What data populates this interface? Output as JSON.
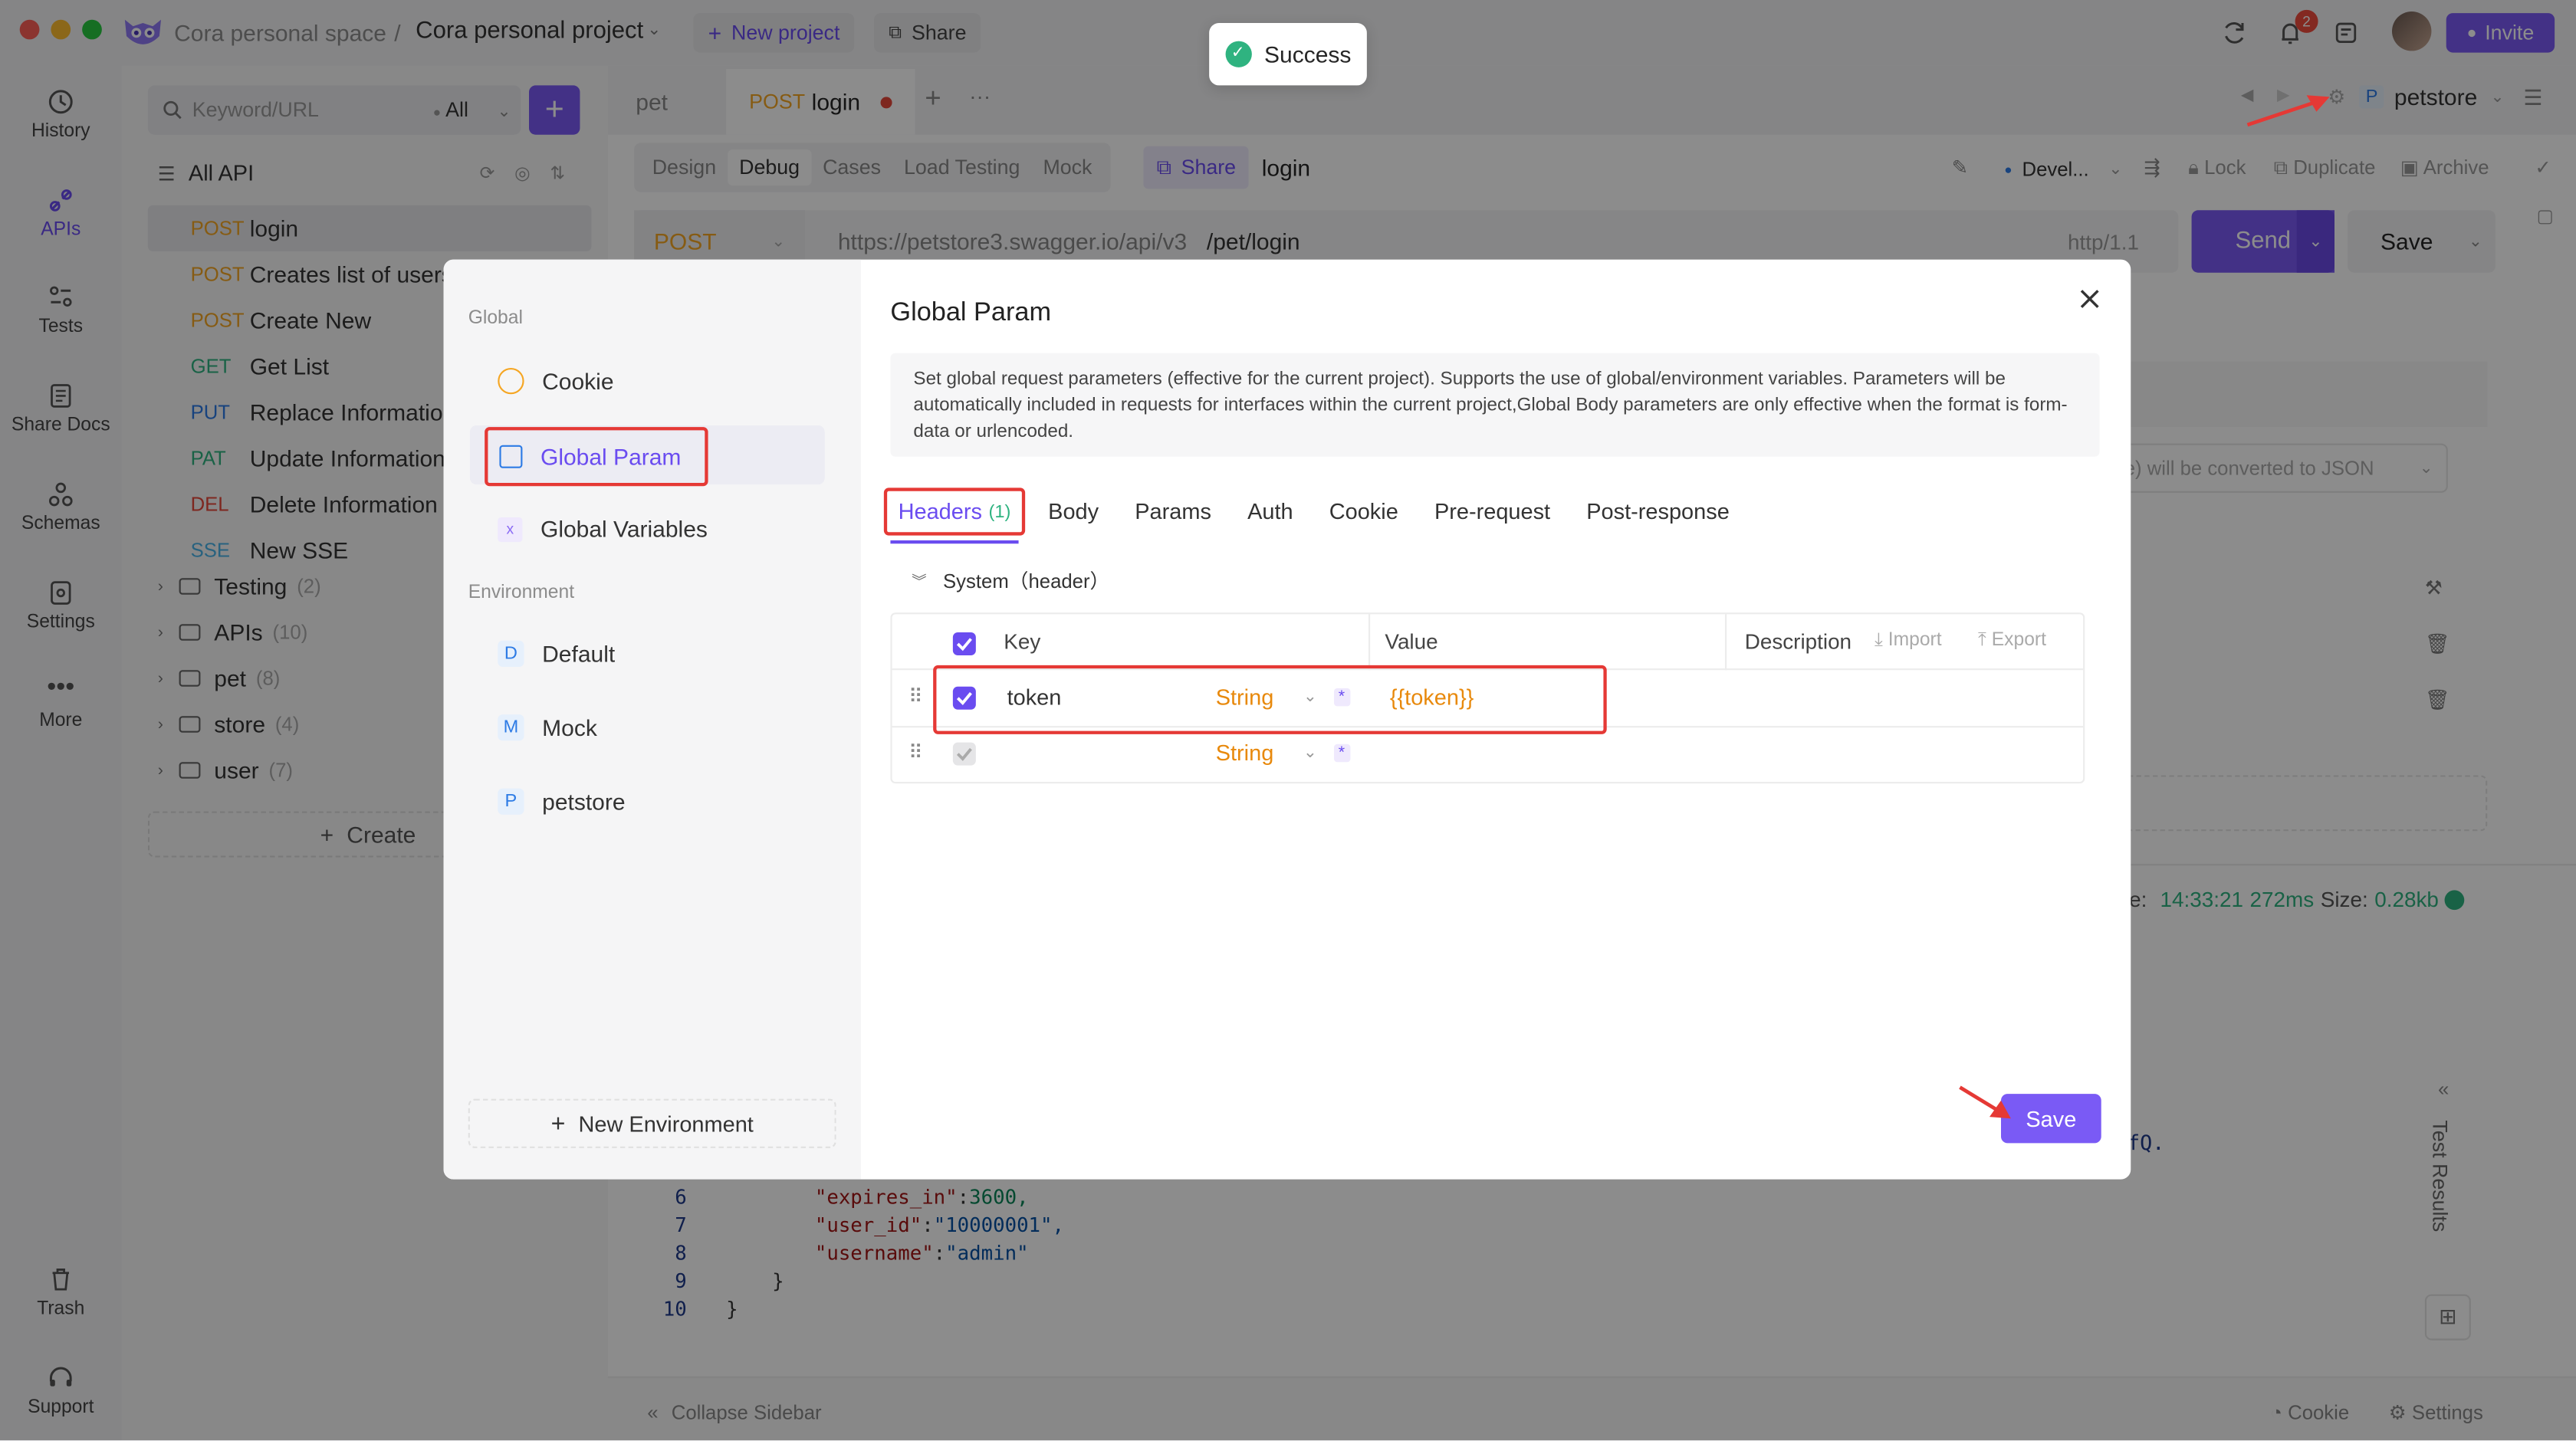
{
  "titlebar": {
    "space": "Cora personal space",
    "separator": "/",
    "project": "Cora personal project",
    "new_project": "New project",
    "share": "Share",
    "notifications_count": "2",
    "invite": "Invite"
  },
  "toast": {
    "text": "Success"
  },
  "nav": {
    "history": "History",
    "apis": "APIs",
    "tests": "Tests",
    "share_docs": "Share Docs",
    "schemas": "Schemas",
    "settings": "Settings",
    "more": "More",
    "trash": "Trash",
    "support": "Support"
  },
  "sidebar": {
    "search_placeholder": "Keyword/URL",
    "filter": "All",
    "all_api": "All API",
    "items": [
      {
        "method": "POST",
        "name": "login",
        "color": "#f5a623"
      },
      {
        "method": "POST",
        "name": "Creates list of users",
        "color": "#f5a623"
      },
      {
        "method": "POST",
        "name": "Create New",
        "color": "#f5a623"
      },
      {
        "method": "GET",
        "name": "Get List",
        "color": "#2fb380"
      },
      {
        "method": "PUT",
        "name": "Replace Information",
        "color": "#2d7be5"
      },
      {
        "method": "PAT",
        "name": "Update Information",
        "color": "#2fb380"
      },
      {
        "method": "DEL",
        "name": "Delete Information",
        "color": "#e5483a"
      },
      {
        "method": "SSE",
        "name": "New SSE",
        "color": "#4ab3e8"
      }
    ],
    "folders": [
      {
        "name": "Testing",
        "count": "(2)"
      },
      {
        "name": "APIs",
        "count": "(10)"
      },
      {
        "name": "pet",
        "count": "(8)"
      },
      {
        "name": "store",
        "count": "(4)"
      },
      {
        "name": "user",
        "count": "(7)"
      }
    ],
    "create": "Create",
    "collapse": "Collapse Sidebar"
  },
  "tabs": {
    "pet": "pet",
    "active_method": "POST",
    "active_name": "login",
    "env": "petstore",
    "env_letter": "P"
  },
  "subtabs": {
    "design": "Design",
    "debug": "Debug",
    "cases": "Cases",
    "load_testing": "Load Testing",
    "mock": "Mock",
    "share": "Share",
    "api_name": "login",
    "env_short": "Devel...",
    "lock": "Lock",
    "duplicate": "Duplicate",
    "archive": "Archive"
  },
  "request": {
    "method": "POST",
    "base_url": "https://petstore3.swagger.io/api/v3",
    "path": "/pet/login",
    "protocol": "http/1.1",
    "send": "Send",
    "save": "Save"
  },
  "background_text": {
    "json_hint": "L-like) will be converted to JSON",
    "time_label": "e:",
    "time": "14:33:21",
    "duration": "272ms",
    "size_label": "Size:",
    "size": "0.28kb",
    "frag": "fQ.",
    "test_results": "Test Results",
    "cookie": "Cookie",
    "settings": "Settings"
  },
  "code": [
    {
      "n": "6",
      "key": "\"expires_in\"",
      "val": "3600,",
      "type": "num"
    },
    {
      "n": "7",
      "key": "\"user_id\"",
      "val": "\"10000001\",",
      "type": "str"
    },
    {
      "n": "8",
      "key": "\"username\"",
      "val": "\"admin\"",
      "type": "str"
    },
    {
      "n": "9",
      "key": "}",
      "val": "",
      "type": "brace"
    },
    {
      "n": "10",
      "key": "}",
      "val": "",
      "type": "brace0"
    }
  ],
  "modal": {
    "global_section": "Global",
    "cookie": "Cookie",
    "global_param": "Global Param",
    "global_variables": "Global Variables",
    "environment_section": "Environment",
    "envs": [
      {
        "letter": "D",
        "name": "Default",
        "color": "#2d7be5",
        "bg": "#e6f0fc"
      },
      {
        "letter": "M",
        "name": "Mock",
        "color": "#2d7be5",
        "bg": "#e6f0fc"
      },
      {
        "letter": "P",
        "name": "petstore",
        "color": "#2d7be5",
        "bg": "#e6f0fc"
      }
    ],
    "new_environment": "New Environment",
    "title": "Global Param",
    "description": "Set global request parameters (effective for the current project). Supports the use of global/environment variables. Parameters will be automatically included in requests for interfaces within the current project,Global Body parameters are only effective when the format is form-data or urlencoded.",
    "tabs": [
      "Body",
      "Params",
      "Auth",
      "Cookie",
      "Pre-request",
      "Post-response"
    ],
    "headers_tab": "Headers",
    "headers_count": "(1)",
    "system_header": "System（header）",
    "col_key": "Key",
    "col_value": "Value",
    "col_description": "Description",
    "import": "Import",
    "export": "Export",
    "rows": [
      {
        "key": "token",
        "type": "String",
        "value": "{{token}}"
      },
      {
        "key": "",
        "type": "String",
        "value": ""
      }
    ],
    "save": "Save"
  }
}
